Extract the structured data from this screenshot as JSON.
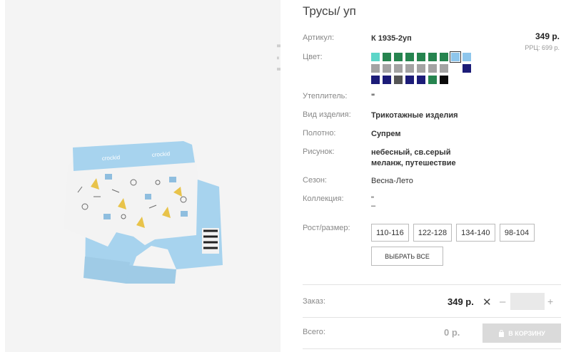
{
  "product": {
    "title": "Трусы/ уп",
    "brand": "crockid",
    "price": "349 р.",
    "rrc": "РРЦ: 699 р."
  },
  "specs": {
    "article_label": "Артикул:",
    "article_value": "К 1935-2уп",
    "color_label": "Цвет:",
    "insulation_label": "Утеплитель:",
    "insulation_value": "\"",
    "type_label": "Вид изделия:",
    "type_value": "Трикотажные изделия",
    "fabric_label": "Полотно:",
    "fabric_value": "Супрем",
    "pattern_label": "Рисунок:",
    "pattern_line1": "небесный, св.серый",
    "pattern_line2": "меланж, путешествие",
    "season_label": "Сезон:",
    "season_value": "Весна-Лето",
    "collection_label": "Коллекция:",
    "collection_value_1": "\"",
    "collection_value_2": "–",
    "size_label": "Рост/размер:"
  },
  "swatches": [
    [
      "#5dd6c8",
      "#26844f",
      "#26844f",
      "#26844f",
      "#26844f",
      "#26844f",
      "#26844f",
      "#8ec6ec",
      "#8ec6ec"
    ],
    [
      "#a3a3a3",
      "#a3a3a3",
      "#a3a3a3",
      "#a3a3a3",
      "#a3a3a3",
      "#a3a3a3",
      "#a3a3a3",
      "",
      "#1c1c78"
    ],
    [
      "#1c1c78",
      "#1c1c78",
      "#555555",
      "#1c1c78",
      "#1c1c78",
      "#26844f",
      "#0a0a0a"
    ]
  ],
  "selected_swatch": "row1-col8",
  "sizes": [
    "110-116",
    "122-128",
    "134-140",
    "98-104"
  ],
  "select_all": "ВЫБРАТЬ ВСЕ",
  "order": {
    "label": "Заказ:",
    "price": "349 р.",
    "remove": "✕",
    "minus": "–",
    "quantity": "",
    "plus": "+"
  },
  "total": {
    "label": "Всего:",
    "value": "0 р.",
    "cart_button": "В КОРЗИНУ"
  },
  "colors": {
    "photo_bg": "#f4f4f4",
    "garment_blue": "#a7d3ee",
    "cart_disabled": "#dadada"
  }
}
